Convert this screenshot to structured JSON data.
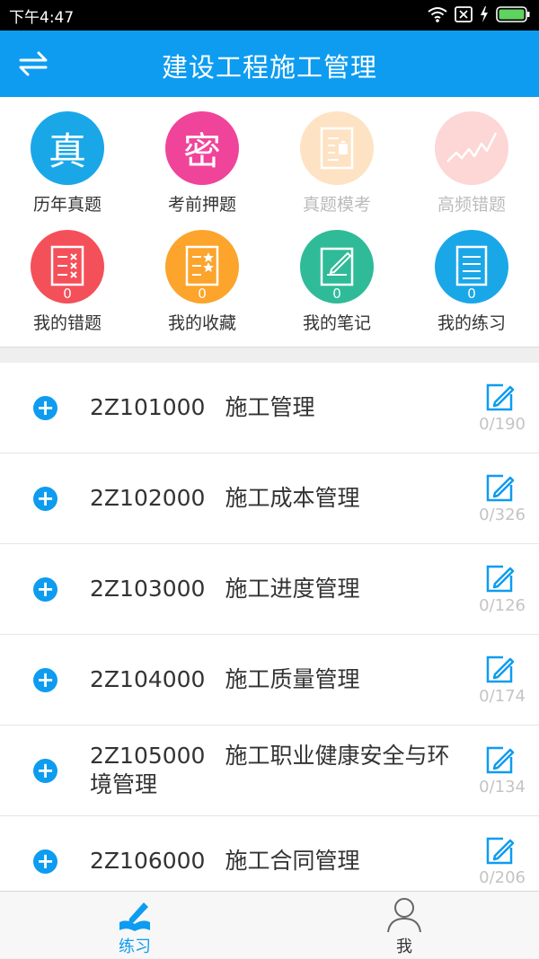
{
  "status_bar": {
    "time": "下午4:47"
  },
  "header": {
    "title": "建设工程施工管理",
    "switch_icon": "swap-arrows-icon"
  },
  "grid": [
    {
      "label": "历年真题",
      "glyph": "真",
      "color": "#1aa7e8",
      "enabled": true
    },
    {
      "label": "考前押题",
      "glyph": "密",
      "color": "#f0449a",
      "enabled": true
    },
    {
      "label": "真题模考",
      "icon": "android-doc-icon",
      "color": "#fde3c4",
      "enabled": false
    },
    {
      "label": "高频错题",
      "icon": "trend-chart-icon",
      "color": "#fdd6d6",
      "enabled": false
    },
    {
      "label": "我的错题",
      "count": "0",
      "icon": "wrong-list-icon",
      "color": "#f4505a",
      "enabled": true
    },
    {
      "label": "我的收藏",
      "count": "0",
      "icon": "star-list-icon",
      "color": "#fca42b",
      "enabled": true
    },
    {
      "label": "我的笔记",
      "count": "0",
      "icon": "note-pen-icon",
      "color": "#2fbb98",
      "enabled": true
    },
    {
      "label": "我的练习",
      "count": "0",
      "icon": "practice-book-icon",
      "color": "#1aa7e8",
      "enabled": true
    }
  ],
  "chapters": [
    {
      "code": "2Z101000",
      "name": "施工管理",
      "progress": "0/190"
    },
    {
      "code": "2Z102000",
      "name": "施工成本管理",
      "progress": "0/326"
    },
    {
      "code": "2Z103000",
      "name": "施工进度管理",
      "progress": "0/126"
    },
    {
      "code": "2Z104000",
      "name": "施工质量管理",
      "progress": "0/174"
    },
    {
      "code": "2Z105000",
      "name": "施工职业健康安全与环境管理",
      "progress": "0/134"
    },
    {
      "code": "2Z106000",
      "name": "施工合同管理",
      "progress": "0/206"
    }
  ],
  "tabs": [
    {
      "label": "练习",
      "icon": "pencil-book-icon",
      "active": true
    },
    {
      "label": "我",
      "icon": "person-icon",
      "active": false
    }
  ],
  "colors": {
    "accent": "#0d9cf0",
    "progress": "#c4c4c4"
  }
}
